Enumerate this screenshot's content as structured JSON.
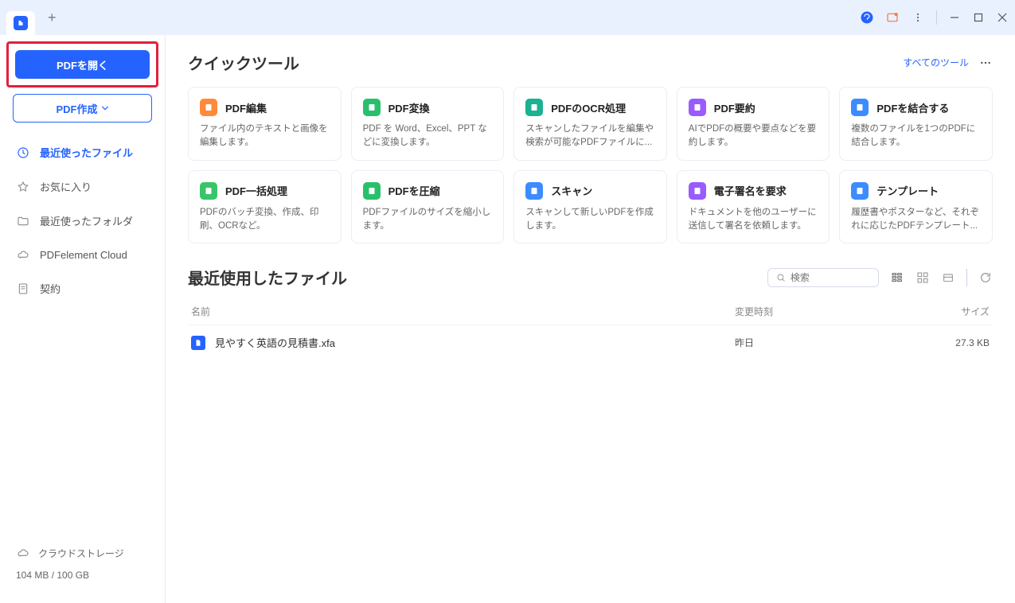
{
  "titlebar": {},
  "sidebar": {
    "open_btn": "PDFを開く",
    "create_btn": "PDF作成",
    "nav": [
      {
        "label": "最近使ったファイル"
      },
      {
        "label": "お気に入り"
      },
      {
        "label": "最近使ったフォルダ"
      },
      {
        "label": "PDFelement Cloud"
      },
      {
        "label": "契約"
      }
    ],
    "cloud_storage_label": "クラウドストレージ",
    "storage_used": "104 MB / 100 GB"
  },
  "quick_tools": {
    "title": "クイックツール",
    "all_tools_link": "すべてのツール",
    "tools": [
      {
        "title": "PDF編集",
        "desc": "ファイル内のテキストと画像を編集します。",
        "color": "#FF8A3C"
      },
      {
        "title": "PDF変換",
        "desc": "PDF を Word、Excel、PPT などに変換します。",
        "color": "#2AC06B"
      },
      {
        "title": "PDFのOCR処理",
        "desc": "スキャンしたファイルを編集や検索が可能なPDFファイルに...",
        "color": "#1BB191"
      },
      {
        "title": "PDF要約",
        "desc": "AIでPDFの概要や要点などを要約します。",
        "color": "#9A5CFF"
      },
      {
        "title": "PDFを結合する",
        "desc": "複数のファイルを1つのPDFに結合します。",
        "color": "#3C8CFF"
      },
      {
        "title": "PDF一括処理",
        "desc": "PDFのバッチ変換、作成、印刷、OCRなど。",
        "color": "#38C56A"
      },
      {
        "title": "PDFを圧縮",
        "desc": "PDFファイルのサイズを縮小します。",
        "color": "#2AC06B"
      },
      {
        "title": "スキャン",
        "desc": "スキャンして新しいPDFを作成します。",
        "color": "#3C8CFF"
      },
      {
        "title": "電子署名を要求",
        "desc": "ドキュメントを他のユーザーに送信して署名を依頼します。",
        "color": "#9A5CFF"
      },
      {
        "title": "テンプレート",
        "desc": "履歴書やポスターなど、それぞれに応じたPDFテンプレート...",
        "color": "#3C8CFF"
      }
    ]
  },
  "recent": {
    "title": "最近使用したファイル",
    "search_placeholder": "検索",
    "columns": {
      "name": "名前",
      "date": "変更時刻",
      "size": "サイズ"
    },
    "rows": [
      {
        "name": "見やすく英語の見積書.xfa",
        "date": "昨日",
        "size": "27.3 KB"
      }
    ]
  }
}
